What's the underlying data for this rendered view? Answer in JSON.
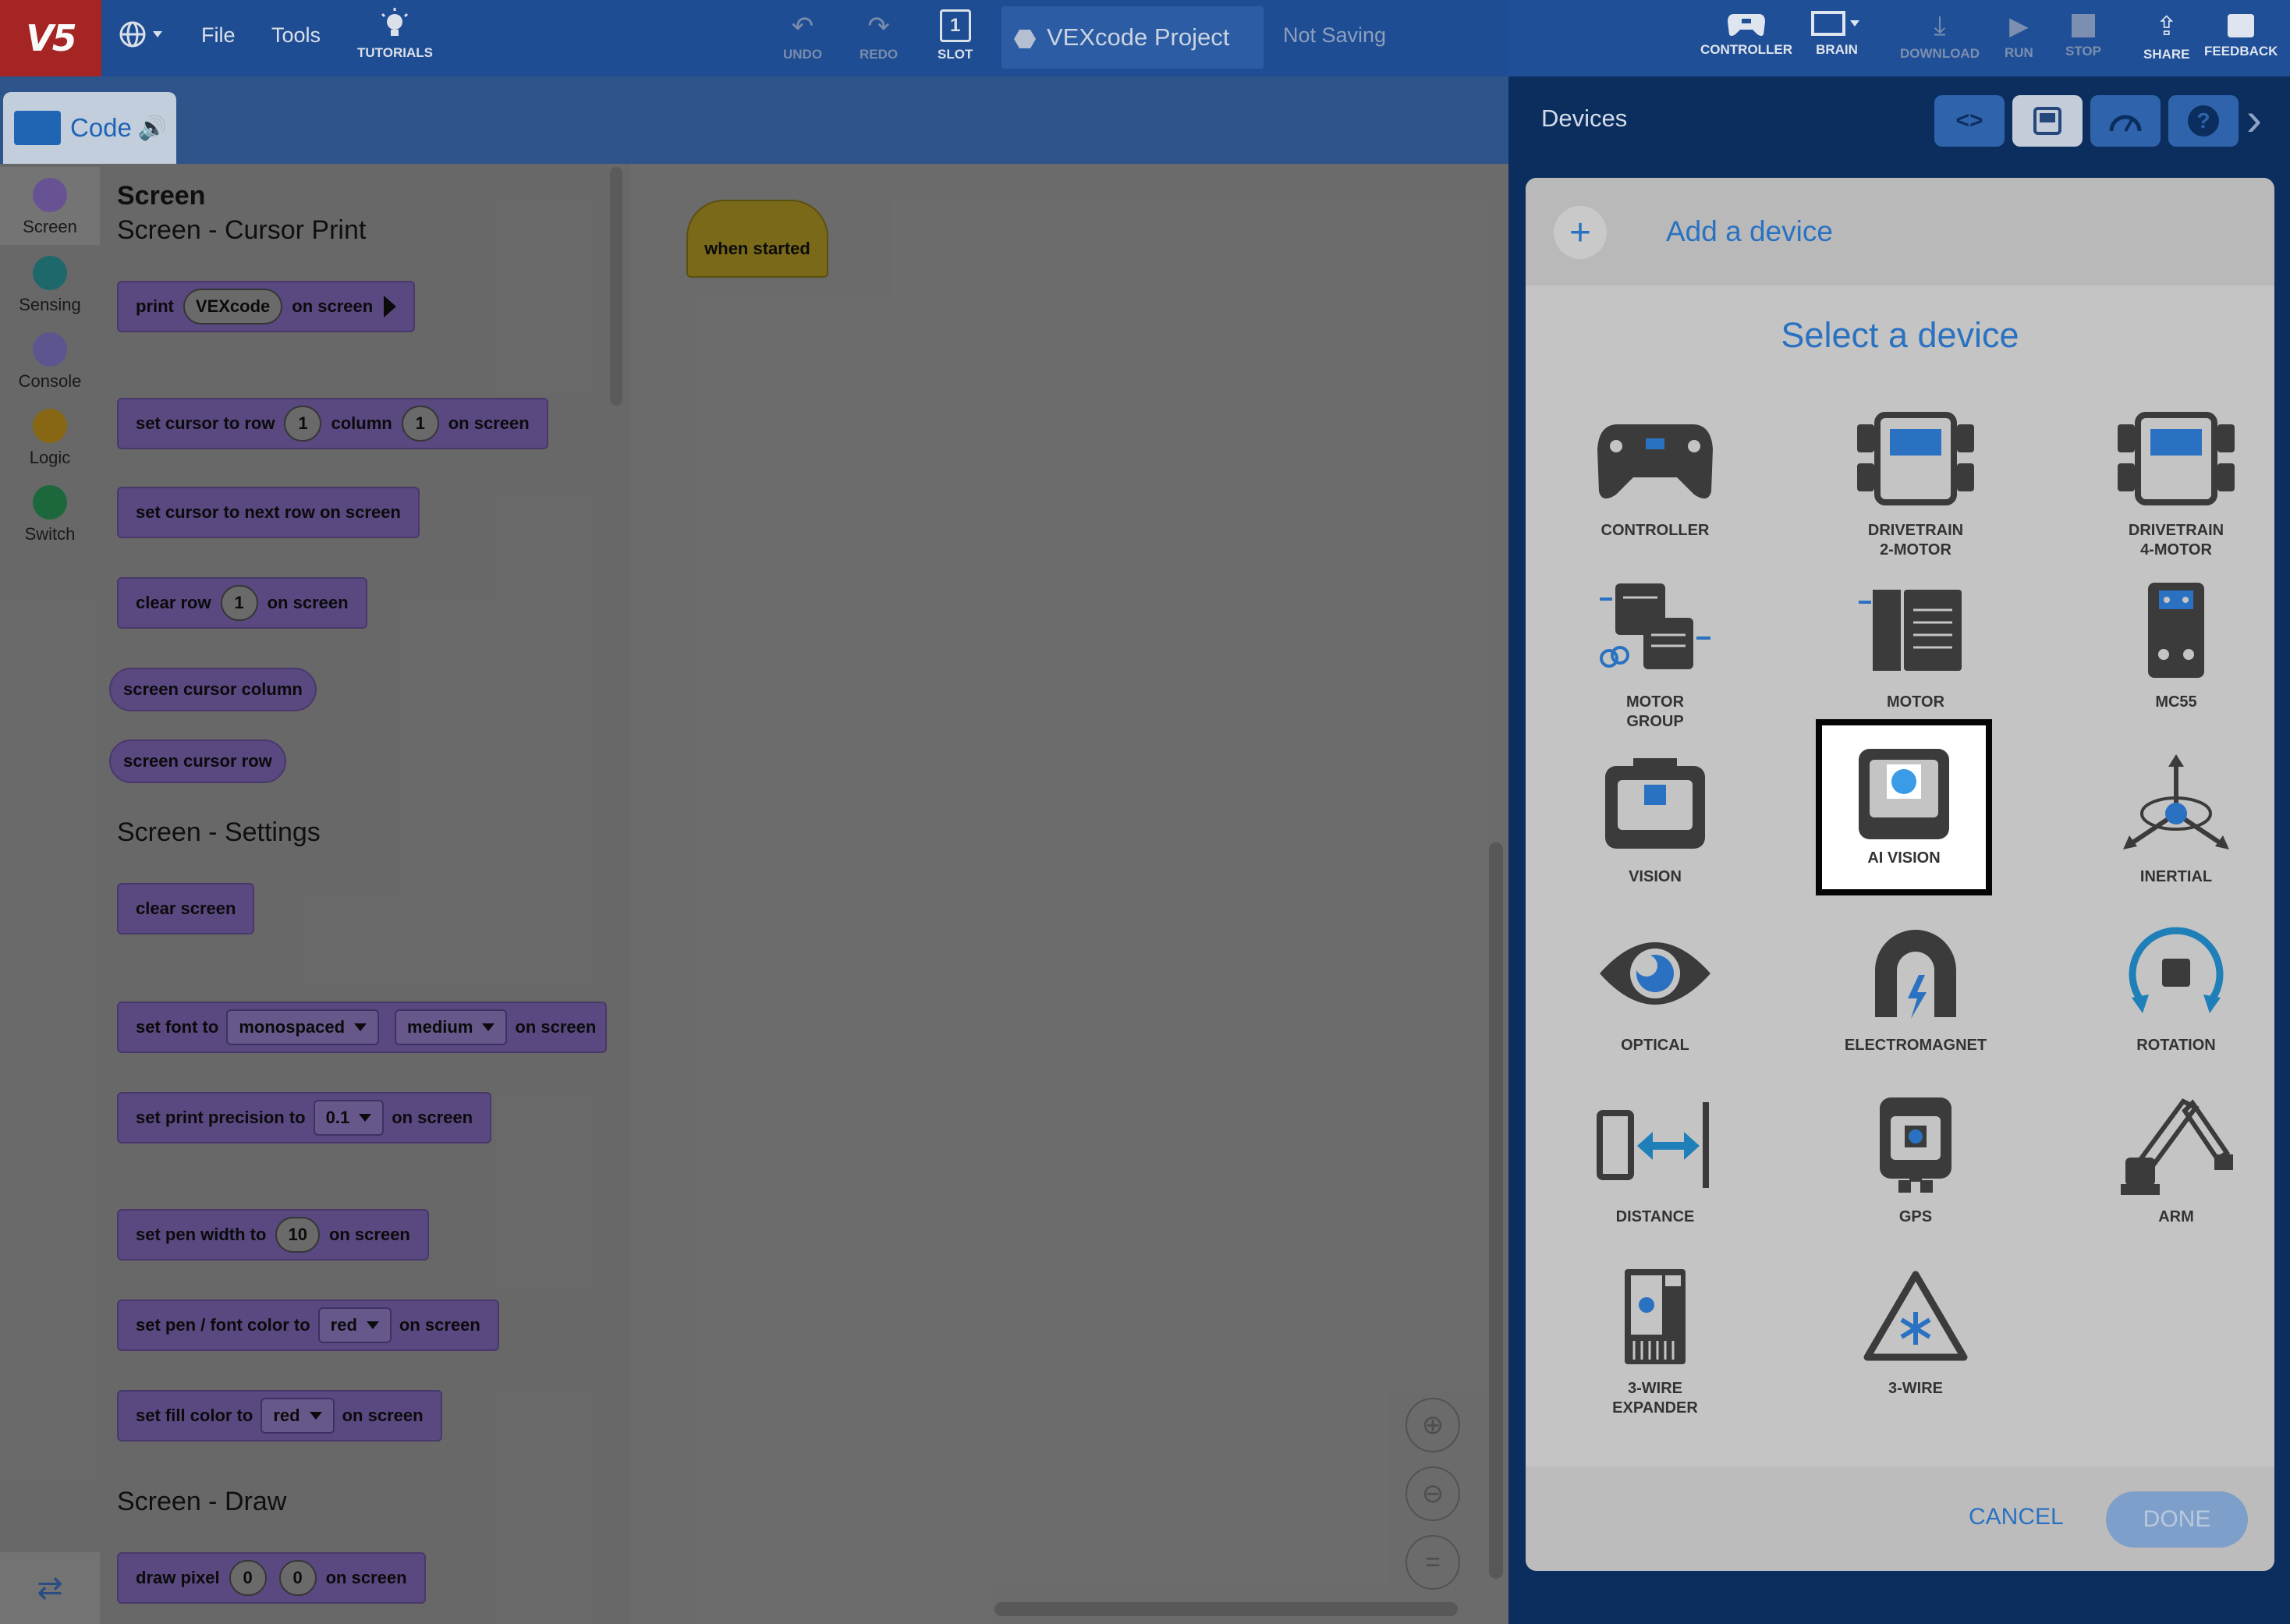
{
  "topbar": {
    "logo": "V5",
    "file": "File",
    "tools": "Tools",
    "tutorials": "TUTORIALS",
    "undo": "UNDO",
    "redo": "REDO",
    "slot": "SLOT",
    "slot_number": "1",
    "project_name": "VEXcode Project",
    "save_status": "Not Saving",
    "controller": "CONTROLLER",
    "brain": "BRAIN",
    "download": "DOWNLOAD",
    "run": "RUN",
    "stop": "STOP",
    "share": "SHARE",
    "feedback": "FEEDBACK"
  },
  "code_tab": {
    "label": "Code"
  },
  "categories": [
    {
      "label": "Screen",
      "color": "#6a5497"
    },
    {
      "label": "Sensing",
      "color": "#1f6b6e"
    },
    {
      "label": "Console",
      "color": "#5d5793"
    },
    {
      "label": "Logic",
      "color": "#8a6a14"
    },
    {
      "label": "Switch",
      "color": "#1d6b3e"
    }
  ],
  "flyout": {
    "title": "Screen",
    "sections": {
      "cursor_print": "Screen - Cursor Print",
      "settings": "Screen - Settings",
      "draw": "Screen - Draw"
    },
    "blocks": {
      "print": {
        "a": "print",
        "val": "VEXcode",
        "b": "on screen"
      },
      "set_cursor": {
        "a": "set cursor to row",
        "row": "1",
        "b": "column",
        "col": "1",
        "c": "on screen"
      },
      "next_row": "set cursor to next row on screen",
      "clear_row": {
        "a": "clear row",
        "val": "1",
        "b": "on screen"
      },
      "cursor_column": "screen cursor column",
      "cursor_row": "screen cursor row",
      "clear_screen": "clear screen",
      "set_font": {
        "a": "set font to",
        "font": "monospaced",
        "size": "medium",
        "b": "on screen"
      },
      "precision": {
        "a": "set print precision to",
        "val": "0.1",
        "b": "on screen"
      },
      "pen_width": {
        "a": "set pen width to",
        "val": "10",
        "b": "on screen"
      },
      "pen_color": {
        "a": "set pen / font color to",
        "val": "red",
        "b": "on screen"
      },
      "fill_color": {
        "a": "set fill color to",
        "val": "red",
        "b": "on screen"
      },
      "draw_pixel": {
        "a": "draw pixel",
        "x": "0",
        "y": "0",
        "b": "on screen"
      }
    }
  },
  "canvas": {
    "hat_block": "when started"
  },
  "devices_panel": {
    "title": "Devices",
    "add_device": "Add a device",
    "select_title": "Select a device",
    "devices": [
      {
        "line1": "CONTROLLER",
        "line2": "",
        "icon": "controller-icon"
      },
      {
        "line1": "DRIVETRAIN",
        "line2": "2-MOTOR",
        "icon": "drivetrain-2-motor-icon"
      },
      {
        "line1": "DRIVETRAIN",
        "line2": "4-MOTOR",
        "icon": "drivetrain-4-motor-icon"
      },
      {
        "line1": "MOTOR",
        "line2": "GROUP",
        "icon": "motor-group-icon"
      },
      {
        "line1": "MOTOR",
        "line2": "",
        "icon": "motor-icon"
      },
      {
        "line1": "MC55",
        "line2": "",
        "icon": "mc55-icon"
      },
      {
        "line1": "VISION",
        "line2": "",
        "icon": "vision-icon"
      },
      {
        "line1": "AI VISION",
        "line2": "",
        "icon": "ai-vision-icon"
      },
      {
        "line1": "INERTIAL",
        "line2": "",
        "icon": "inertial-icon"
      },
      {
        "line1": "OPTICAL",
        "line2": "",
        "icon": "optical-icon"
      },
      {
        "line1": "ELECTROMAGNET",
        "line2": "",
        "icon": "electromagnet-icon"
      },
      {
        "line1": "ROTATION",
        "line2": "",
        "icon": "rotation-icon"
      },
      {
        "line1": "DISTANCE",
        "line2": "",
        "icon": "distance-icon"
      },
      {
        "line1": "GPS",
        "line2": "",
        "icon": "gps-icon"
      },
      {
        "line1": "ARM",
        "line2": "",
        "icon": "arm-icon"
      },
      {
        "line1": "3-WIRE",
        "line2": "EXPANDER",
        "icon": "three-wire-expander-icon"
      },
      {
        "line1": "3-WIRE",
        "line2": "",
        "icon": "three-wire-icon"
      }
    ],
    "highlighted_device": "AI VISION",
    "cancel": "CANCEL",
    "done": "DONE"
  },
  "colors": {
    "topbar": "#1f4f96",
    "accent_blue": "#2a72c1",
    "block_purple": "#5c4a84",
    "hat_yellow": "#7d6c1a"
  }
}
